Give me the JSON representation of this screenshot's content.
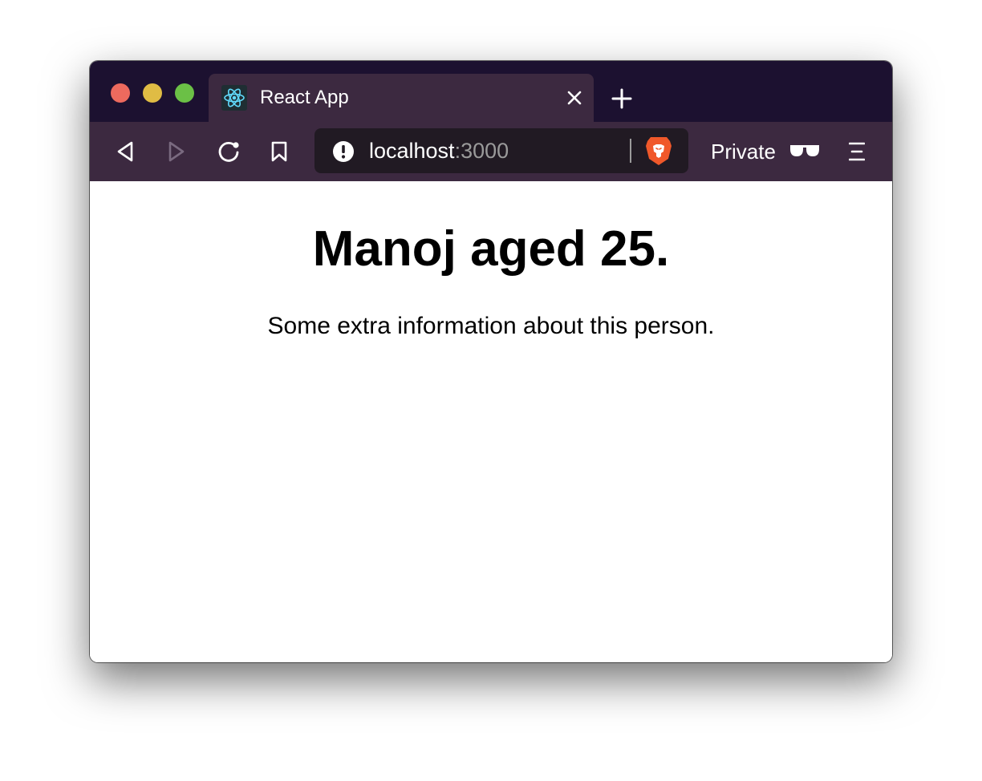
{
  "browser": {
    "tab": {
      "title": "React App",
      "favicon": "react-atom-icon"
    },
    "toolbar": {
      "url_host": "localhost",
      "url_port": ":3000",
      "private_label": "Private"
    }
  },
  "page": {
    "heading": "Manoj aged 25.",
    "description": "Some extra information about this person."
  },
  "colors": {
    "tabstrip": "#1c1130",
    "toolbar": "#3c2940",
    "urlbar": "#211a23",
    "brave_orange": "#f0582a",
    "react_teal": "#61dafb"
  }
}
